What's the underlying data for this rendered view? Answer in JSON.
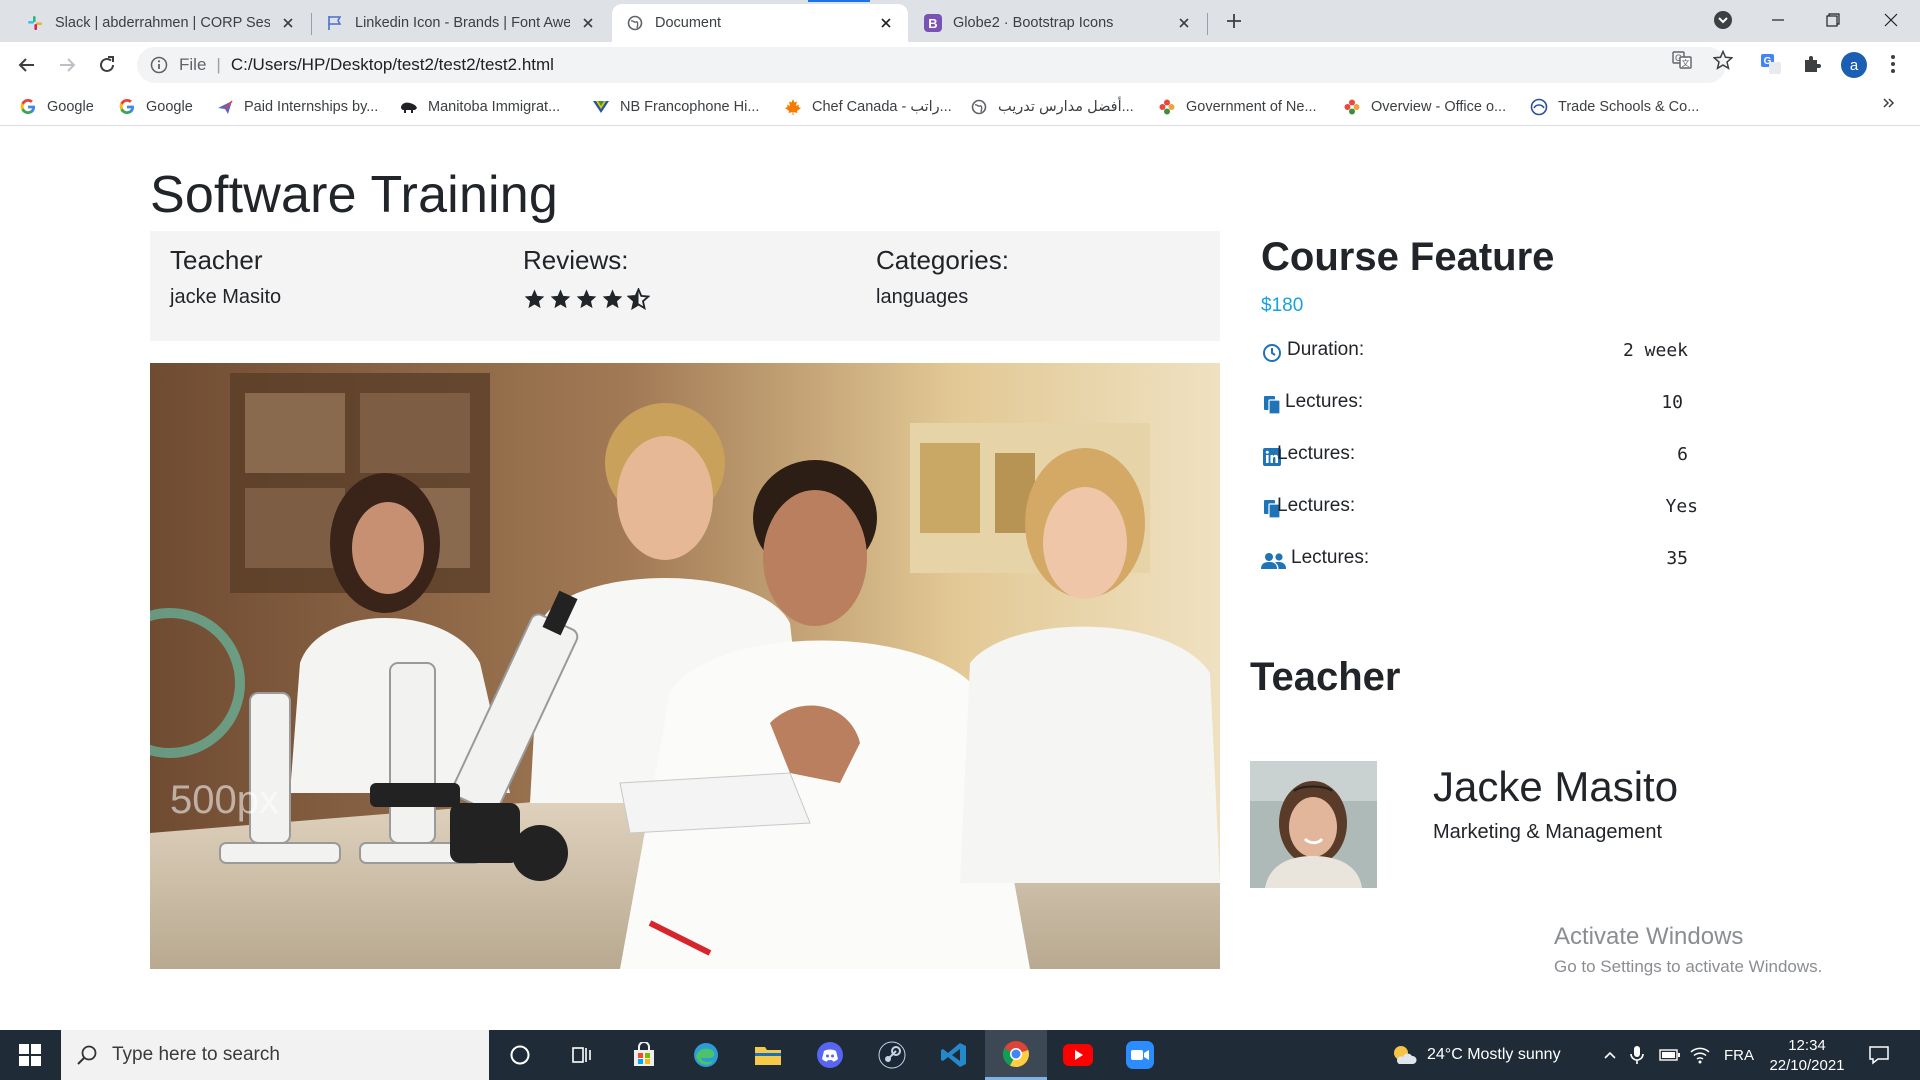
{
  "browser": {
    "tabs": [
      {
        "title": "Slack | abderrahmen | CORP Sess",
        "favicon": "slack-icon",
        "active": false
      },
      {
        "title": "Linkedin Icon - Brands | Font Awe",
        "favicon": "flag-icon",
        "active": false
      },
      {
        "title": "Document",
        "favicon": "globe-icon",
        "active": true
      },
      {
        "title": "Globe2 · Bootstrap Icons",
        "favicon": "bootstrap-icon",
        "active": false
      }
    ],
    "address": {
      "scheme": "File",
      "url": "C:/Users/HP/Desktop/test2/test2/test2.html"
    },
    "profile_initial": "a",
    "bookmarks": [
      {
        "label": "Google",
        "icon": "google-icon"
      },
      {
        "label": "Google",
        "icon": "google-icon"
      },
      {
        "label": "Paid Internships by...",
        "icon": "airplane-icon"
      },
      {
        "label": "Manitoba Immigrat...",
        "icon": "bison-icon"
      },
      {
        "label": "NB Francophone Hi...",
        "icon": "nb-flag-icon"
      },
      {
        "label": "Chef Canada - راتب...",
        "icon": "maple-leaf-icon"
      },
      {
        "label": "أفضل مدارس تدريب...",
        "icon": "globe-icon"
      },
      {
        "label": "Government of Ne...",
        "icon": "flower-icon"
      },
      {
        "label": "Overview - Office o...",
        "icon": "flower-icon"
      },
      {
        "label": "Trade Schools & Co...",
        "icon": "school-icon"
      }
    ]
  },
  "page": {
    "title": "Software Training",
    "info": {
      "teacher_label": "Teacher",
      "teacher_value": "jacke Masito",
      "reviews_label": "Reviews:",
      "rating": 4.5,
      "categories_label": "Categories:",
      "categories_value": "languages"
    },
    "hero_alt": "students-in-lab-photo",
    "watermark": "500px",
    "feature": {
      "title": "Course Feature",
      "price": "$180",
      "rows": [
        {
          "icon": "clock-icon",
          "label": "Duration:",
          "value": "2 week"
        },
        {
          "icon": "copy-icon",
          "label": "Lectures:",
          "value": "10"
        },
        {
          "icon": "linkedin-icon",
          "label": "Lectures:",
          "value": "6"
        },
        {
          "icon": "copy-icon",
          "label": "Lectures:",
          "value": "Yes"
        },
        {
          "icon": "users-icon",
          "label": "Lectures:",
          "value": "35"
        }
      ]
    },
    "teacher": {
      "section_title": "Teacher",
      "name": "Jacke Masito",
      "role": "Marketing & Management"
    },
    "activate": {
      "line1": "Activate Windows",
      "line2": "Go to Settings to activate Windows."
    }
  },
  "taskbar": {
    "search_placeholder": "Type here to search",
    "weather": "24°C  Mostly sunny",
    "language": "FRA",
    "time": "12:34",
    "date": "22/10/2021",
    "apps": [
      "cortana-icon",
      "task-view-icon",
      "store-icon",
      "edge-icon",
      "file-explorer-icon",
      "discord-icon",
      "steam-icon",
      "vscode-icon",
      "chrome-icon",
      "youtube-icon",
      "zoom-icon"
    ]
  }
}
